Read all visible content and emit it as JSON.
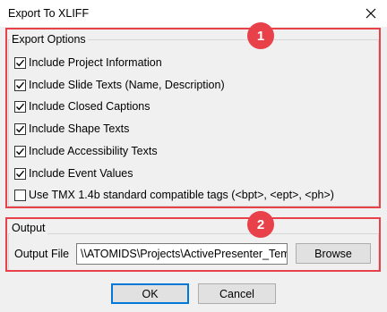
{
  "window": {
    "title": "Export To XLIFF",
    "close_icon": "close-icon"
  },
  "export_options": {
    "legend": "Export Options",
    "badge": "1",
    "checkboxes": [
      {
        "label": "Include Project Information",
        "checked": true
      },
      {
        "label": "Include Slide Texts (Name, Description)",
        "checked": true
      },
      {
        "label": "Include Closed Captions",
        "checked": true
      },
      {
        "label": "Include Shape Texts",
        "checked": true
      },
      {
        "label": "Include Accessibility Texts",
        "checked": true
      },
      {
        "label": "Include Event Values",
        "checked": true
      },
      {
        "label": "Use TMX 1.4b standard compatible tags (<bpt>, <ept>, <ph>)",
        "checked": false
      }
    ]
  },
  "output": {
    "legend": "Output",
    "badge": "2",
    "file_label": "Output File",
    "file_value": "\\\\ATOMIDS\\Projects\\ActivePresenter_Temp",
    "browse_label": "Browse"
  },
  "footer": {
    "ok_label": "OK",
    "cancel_label": "Cancel"
  },
  "colors": {
    "annotation": "#e8414a",
    "focus": "#0078d7"
  }
}
